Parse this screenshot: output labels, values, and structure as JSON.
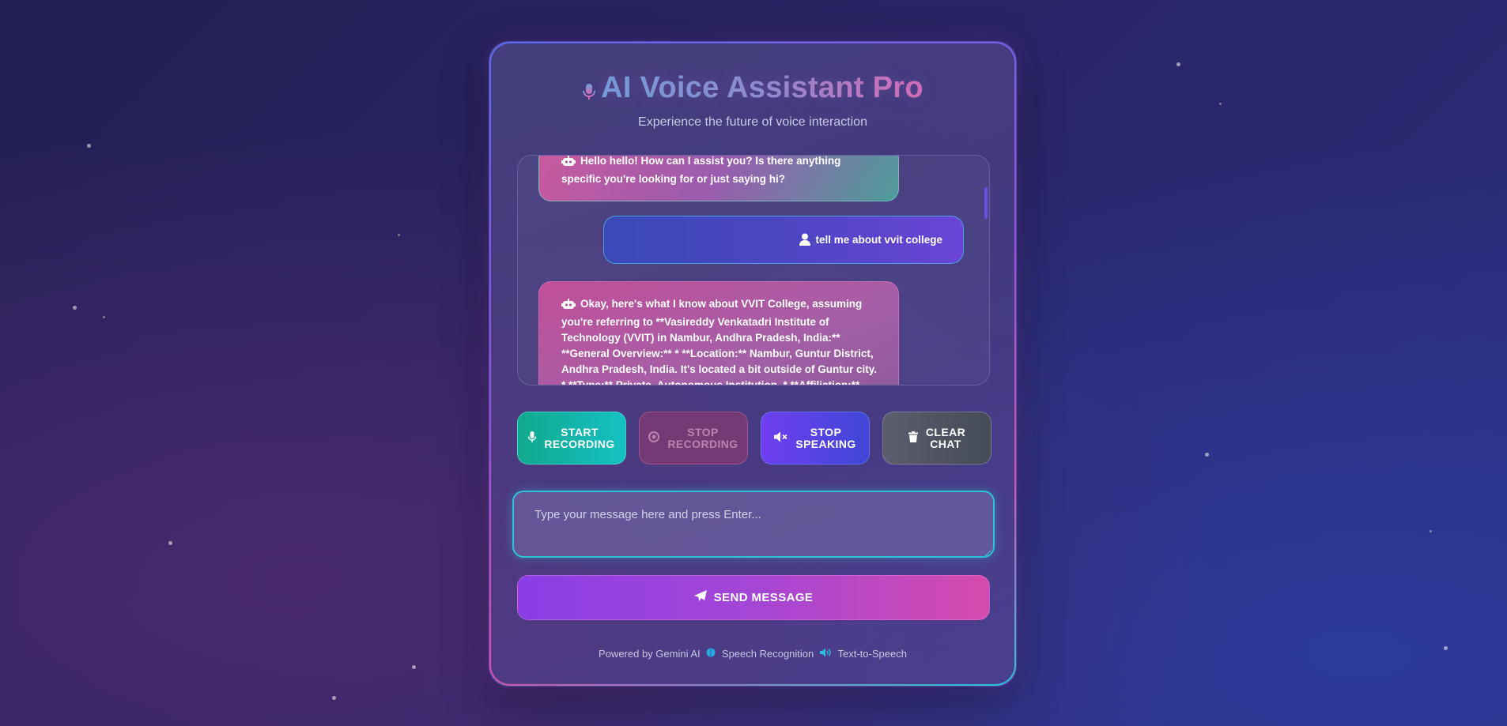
{
  "header": {
    "title": "AI Voice Assistant Pro",
    "subtitle": "Experience the future of voice interaction"
  },
  "chat": {
    "messages": [
      {
        "role": "bot",
        "text": "Hello hello! How can I assist you? Is there anything specific you're looking for or just saying hi?"
      },
      {
        "role": "user",
        "text": "tell me about vvit college"
      },
      {
        "role": "bot",
        "text": "Okay, here's what I know about VVIT College, assuming you're referring to **Vasireddy Venkatadri Institute of Technology (VVIT) in Nambur, Andhra Pradesh, India:** **General Overview:** * **Location:** Nambur, Guntur District, Andhra Pradesh, India. It's located a bit outside of Guntur city. * **Type:** Private, Autonomous Institution. * **Affiliation:**"
      }
    ]
  },
  "controls": {
    "start_recording": {
      "line1": "START",
      "line2": "RECORDING"
    },
    "stop_recording": {
      "line1": "STOP",
      "line2": "RECORDING"
    },
    "stop_speaking": {
      "line1": "STOP",
      "line2": "SPEAKING"
    },
    "clear_chat": {
      "line1": "CLEAR",
      "line2": "CHAT"
    }
  },
  "input": {
    "placeholder": "Type your message here and press Enter...",
    "value": ""
  },
  "send_button": {
    "label": "SEND MESSAGE"
  },
  "footer": {
    "powered_by": "Powered by Gemini AI",
    "speech": "Speech Recognition",
    "tts": "Text-to-Speech"
  },
  "colors": {
    "accent_teal": "#14c1c2",
    "accent_purple": "#8a3ee6",
    "accent_pink": "#d64aae",
    "input_border": "#2ec3d6"
  },
  "icons": {
    "title": "microphone-icon",
    "bot": "robot-icon",
    "user": "user-icon",
    "start": "microphone-icon",
    "stop": "record-stop-icon",
    "speak": "speaker-mute-icon",
    "clear": "trash-icon",
    "send": "paper-plane-icon",
    "speech": "brain-icon",
    "tts": "speaker-icon"
  }
}
